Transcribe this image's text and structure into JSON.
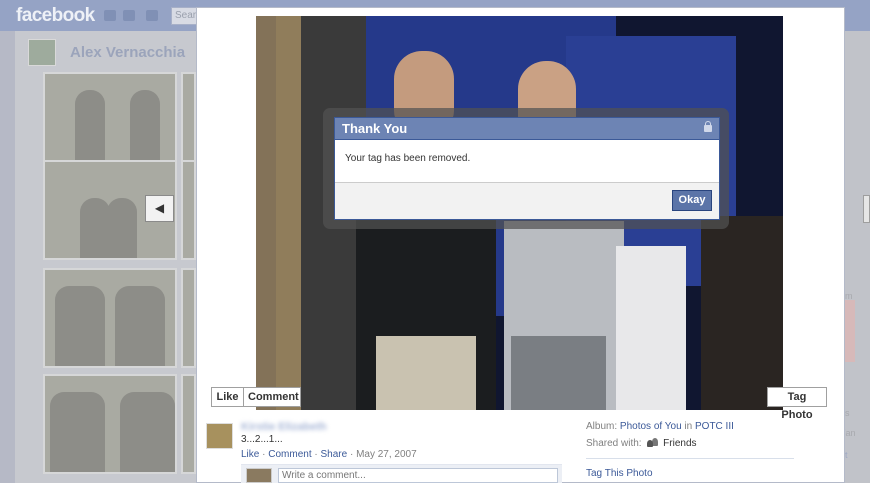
{
  "background": {
    "logo": "facebook",
    "search_placeholder": "Search",
    "profile_name": "Alex Vernacchia",
    "right_fragments": [
      "om",
      "e",
      "t",
      "o",
      "t",
      "es",
      "t",
      "Fan",
      "s",
      "at"
    ]
  },
  "photo_viewer": {
    "prev_label": "◀",
    "like_label": "Like",
    "comment_label": "Comment",
    "tag_photo_label": "Tag Photo"
  },
  "dialog": {
    "title": "Thank You",
    "message": "Your tag has been removed.",
    "okay_label": "Okay"
  },
  "post": {
    "uploader_name": "Kirstie Elizabeth",
    "caption": "3...2...1...",
    "actions": {
      "like": "Like",
      "sep1": " · ",
      "comment": "Comment",
      "sep2": " · ",
      "share": "Share",
      "date": " · May 27, 2007"
    },
    "comment_placeholder": "Write a comment..."
  },
  "sidebar": {
    "album_label": "Album:",
    "album_name": "Photos of You",
    "album_in": "in",
    "album_owner": "POTC III",
    "shared_label": "Shared with:",
    "shared_value": "Friends",
    "tag_this_photo": "Tag This Photo"
  },
  "colors": {
    "brand_blue": "#3b5998",
    "dialog_title_bg": "#6d84b4",
    "okay_button": "#5b74a8"
  }
}
